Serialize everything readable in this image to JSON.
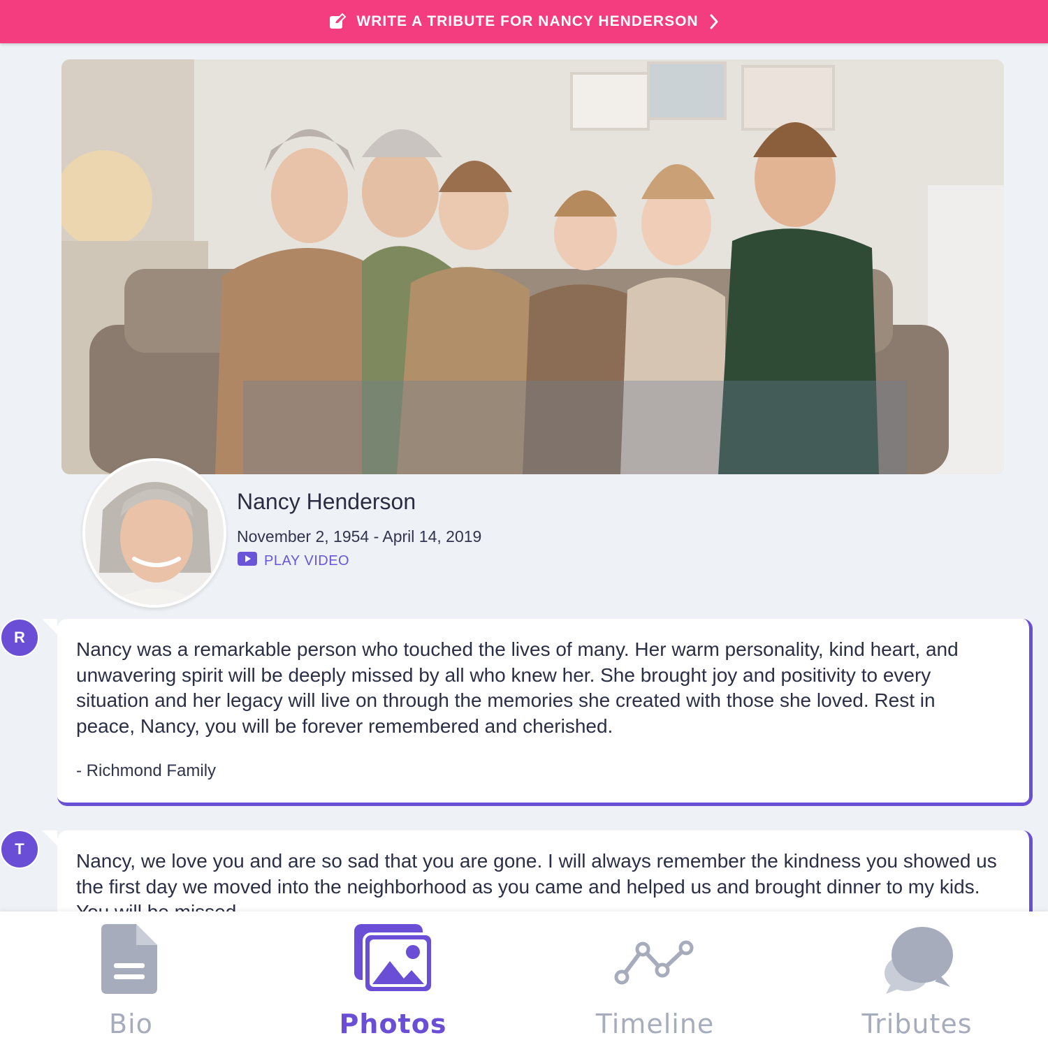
{
  "banner": {
    "label": "WRITE A TRIBUTE FOR NANCY HENDERSON",
    "icon": "edit-icon",
    "chevron": "chevron-right-icon"
  },
  "profile": {
    "name": "Nancy Henderson",
    "dates": "November 2, 1954 - April 14, 2019",
    "play_label": "PLAY VIDEO"
  },
  "tributes": [
    {
      "initial": "R",
      "text": "Nancy was a remarkable person who touched the lives of many. Her warm personality, kind heart, and unwavering spirit will be deeply missed by all who knew her. She brought joy and positivity to every situation and her legacy will live on through the memories she created with those she loved. Rest in peace, Nancy, you will be forever remembered and cherished.",
      "signature": "- Richmond Family"
    },
    {
      "initial": "T",
      "text": "Nancy, we love you and are so sad that you are gone. I will always remember the kindness you showed us the first day we moved into the neighborhood as you came and helped us and brought dinner to my kids. You will be missed."
    }
  ],
  "tabs": [
    {
      "label": "Bio",
      "icon": "document-icon",
      "active": false
    },
    {
      "label": "Photos",
      "icon": "photos-icon",
      "active": true
    },
    {
      "label": "Timeline",
      "icon": "timeline-icon",
      "active": false
    },
    {
      "label": "Tributes",
      "icon": "chat-bubbles-icon",
      "active": false
    }
  ],
  "colors": {
    "accent": "#6a4fd6",
    "banner": "#f43d7e",
    "inactive": "#a7acbc",
    "background": "#eef2f6"
  }
}
